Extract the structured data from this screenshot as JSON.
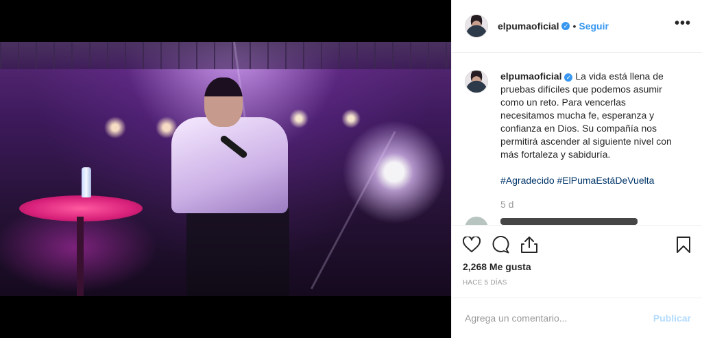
{
  "post": {
    "author": "elpumaoficial",
    "verified_glyph": "✓",
    "separator": "•",
    "follow_label": "Seguir",
    "more_label": "•••",
    "caption_text": "La vida está llena de pruebas difíciles que podemos asumir como un reto. Para vencerlas necesitamos mucha fe, esperanza y confianza en Dios. Su compañía nos permitirá ascender al siguiente nivel con más fortaleza y sabiduría.",
    "hashtags": [
      "#Agradecido",
      "#ElPumaEstáDeVuelta"
    ],
    "caption_age": "5 d",
    "likes": "2,268 Me gusta",
    "time_ago": "HACE 5 DÍAS",
    "comment_placeholder": "Agrega un comentario...",
    "publish_label": "Publicar"
  },
  "icons": {
    "like": "heart-icon",
    "comment": "comment-icon",
    "share": "share-icon",
    "save": "bookmark-icon"
  },
  "colors": {
    "accent": "#3897f0",
    "hashtag": "#003569",
    "muted": "#999999",
    "publish_disabled": "#b3dbff"
  }
}
